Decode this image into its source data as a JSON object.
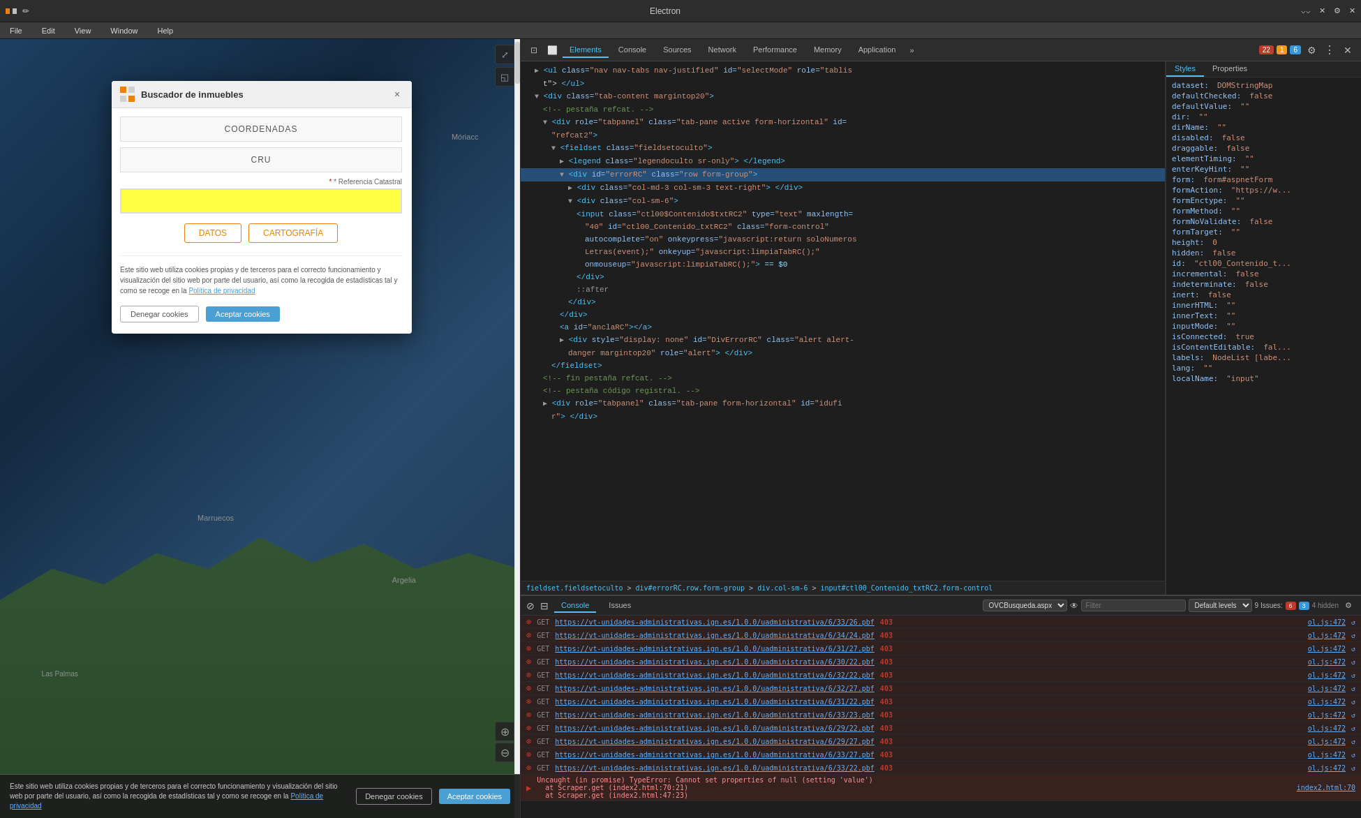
{
  "titleBar": {
    "title": "Electron",
    "iconColor1": "#e8820a",
    "iconColor2": "#e8820a"
  },
  "menuBar": {
    "items": [
      "File",
      "Edit",
      "View",
      "Window",
      "Help"
    ]
  },
  "modal": {
    "title": "Buscador de inmuebles",
    "closeLabel": "×",
    "section1": "COORDENADAS",
    "section2": "CRU",
    "referenciaCatastralLabel": "* Referencia Catastral",
    "inputValue": "~~~~~~~~~~~~~~~~~~~~~~~~~~",
    "datosBtn": "DATOS",
    "cartografiaBtn": "CARTOGRAFÍA",
    "cookieText": "Este sitio web utiliza cookies propias y de terceros para el correcto funcionamiento y visualización del sitio web por parte del usuario, así como la recogida de estadísticas tal y como se recoge en la ",
    "policyLink": "Política de privacidad",
    "denyBtn": "Denegar cookies",
    "acceptBtn": "Aceptar cookies"
  },
  "mapLabels": {
    "marruecos": "Marruecos",
    "argelia": "Argelia",
    "lasPalmas": "Las Palmas",
    "moriace": "Móriacc"
  },
  "cookieBarBottom": {
    "text": "Este sitio web utiliza cookies propias y de terceros para el correcto funcionamiento y visualización del sitio web por parte del usuario, así como la recogida de estadísticas tal y como se recoge en la ",
    "policyLink": "Política de privacidad",
    "denyBtn": "Denegar cookies",
    "acceptBtn": "Aceptar cookies"
  },
  "devtools": {
    "tabs": [
      "Elements",
      "Console",
      "Sources",
      "Network",
      "Performance",
      "Memory",
      "Application"
    ],
    "activeTab": "Elements",
    "badgeError": "22",
    "badgeWarn": "1",
    "badgeInfo": "6",
    "stylesTabs": [
      "Styles",
      "Properties"
    ],
    "activeStylesTab": "Styles"
  },
  "domTree": {
    "lines": [
      "▶ <ul class=\"nav nav-tabs nav-justified\" id=\"selectMode\" role=\"tablis",
      "  t\"> </ul>",
      "▼ <div class=\"tab-content margintop20\">",
      "  <!-- pestaña refcat. -->",
      "  ▼ <div role=\"tabpanel\" class=\"tab-pane active form-horizontal\" id=",
      "    \"refcat2\">",
      "    ▼ <fieldset class=\"fieldsetoculto\">",
      "      ▶ <legend class=\"legendoculto sr-only\"> </legend>",
      "      ▼ <div id=\"errorRC\" class=\"row form-group\">",
      "        ▶ <div class=\"col-md-3 col-sm-3 text-right\"> </div>",
      "        ▼ <div class=\"col-sm-6\">",
      "          <input class=\"ctl00$Contenido$txtRC2\" type=\"text\" maxlength=",
      "            \"40\" id=\"ctl00_Contenido_txtRC2\" class=\"form-control\"",
      "            autocomplete=\"on\" onkeypress=\"javascript:return soloNumeros",
      "            Letras(event);\" onkeyup=\"javascript:limpiaTabRC();\"",
      "            onmouseup=\"javascript:limpiaTabRC();\"> == $0",
      "          </div>",
      "          ::after",
      "        </div>",
      "      </div>",
      "      <a id=\"anclaRC\"></a>",
      "      ▶ <div style=\"display: none\" id=\"DivErrorRC\" class=\"alert alert-",
      "        danger margintop20\" role=\"alert\"> </div>",
      "    </fieldset>",
      "  <!-- fin pestaña refcat. -->",
      "  <!-- pestaña código registral. -->",
      "  ▶ <div role=\"tabpanel\" class=\"tab-pane form-horizontal\" id=\"idufi",
      "    r\"> </div>"
    ]
  },
  "breadcrumb": {
    "parts": [
      "fieldsetoculto",
      "div#errorRC.row.form-group",
      "div.col-sm-6",
      "input#ctl00_Contenido_txtRC2.form-control"
    ]
  },
  "stylesContent": {
    "props": [
      {
        "key": "dataset:",
        "val": "DOMStringMap"
      },
      {
        "key": "defaultChecked:",
        "val": "false"
      },
      {
        "key": "defaultValue:",
        "val": "\"\""
      },
      {
        "key": "dir:",
        "val": "\"\""
      },
      {
        "key": "dirName:",
        "val": "\"\""
      },
      {
        "key": "disabled:",
        "val": "false"
      },
      {
        "key": "draggable:",
        "val": "false"
      },
      {
        "key": "elementTiming:",
        "val": "\"\""
      },
      {
        "key": "enterKeyHint:",
        "val": "\"\""
      },
      {
        "key": "form:",
        "val": "form#aspnetForm"
      },
      {
        "key": "formAction:",
        "val": "\"https://w..."
      },
      {
        "key": "formEnctype:",
        "val": "\"\""
      },
      {
        "key": "formMethod:",
        "val": "\"\""
      },
      {
        "key": "formNoValidate:",
        "val": "false"
      },
      {
        "key": "formTarget:",
        "val": "\"\""
      },
      {
        "key": "height:",
        "val": "0"
      },
      {
        "key": "hidden:",
        "val": "false"
      },
      {
        "key": "id:",
        "val": "\"ctl00_Contenido_t..."
      },
      {
        "key": "incremental:",
        "val": "false"
      },
      {
        "key": "indeterminate:",
        "val": "false"
      },
      {
        "key": "inert:",
        "val": "false"
      },
      {
        "key": "innerHTML:",
        "val": "\"\""
      },
      {
        "key": "innerText:",
        "val": "\"\""
      },
      {
        "key": "inputMode:",
        "val": "\"\""
      },
      {
        "key": "isConnected:",
        "val": "true"
      },
      {
        "key": "isContentEditable:",
        "val": "fal..."
      },
      {
        "key": "labels:",
        "val": "NodeList [labe..."
      },
      {
        "key": "lang:",
        "val": "\"\""
      },
      {
        "key": "localName:",
        "val": "\"input\""
      }
    ]
  },
  "consoleToolbar": {
    "fileName": "OVCBusqueda.aspx",
    "filterPlaceholder": "Filter",
    "levelDefault": "Default levels",
    "issuesCount": "9 Issues:",
    "errorCount": "6",
    "issuesBadge": "3",
    "hiddenCount": "4 hidden"
  },
  "consoleRows": [
    {
      "type": "error",
      "method": "GET",
      "url": "https://vt-unidades-administrativas.ign.es/1.0.0/uadministrativa/6/33/26.pbf",
      "status": "403",
      "file": "ol.js:472",
      "isError": true
    },
    {
      "type": "error",
      "method": "GET",
      "url": "https://vt-unidades-administrativas.ign.es/1.0.0/uadministrativa/6/34/24.pbf",
      "status": "403",
      "file": "ol.js:472",
      "isError": true
    },
    {
      "type": "error",
      "method": "GET",
      "url": "https://vt-unidades-administrativas.ign.es/1.0.0/uadministrativa/6/31/27.pbf",
      "status": "403",
      "file": "ol.js:472",
      "isError": true
    },
    {
      "type": "error",
      "method": "GET",
      "url": "https://vt-unidades-administrativas.ign.es/1.0.0/uadministrativa/6/30/22.pbf",
      "status": "403",
      "file": "ol.js:472",
      "isError": true
    },
    {
      "type": "error",
      "method": "GET",
      "url": "https://vt-unidades-administrativas.ign.es/1.0.0/uadministrativa/6/32/22.pbf",
      "status": "403",
      "file": "ol.js:472",
      "isError": true
    },
    {
      "type": "error",
      "method": "GET",
      "url": "https://vt-unidades-administrativas.ign.es/1.0.0/uadministrativa/6/32/27.pbf",
      "status": "403",
      "file": "ol.js:472",
      "isError": true
    },
    {
      "type": "error",
      "method": "GET",
      "url": "https://vt-unidades-administrativas.ign.es/1.0.0/uadministrativa/6/31/22.pbf",
      "status": "403",
      "file": "ol.js:472",
      "isError": true
    },
    {
      "type": "error",
      "method": "GET",
      "url": "https://vt-unidades-administrativas.ign.es/1.0.0/uadministrativa/6/33/23.pbf",
      "status": "403",
      "file": "ol.js:472",
      "isError": true
    },
    {
      "type": "error",
      "method": "GET",
      "url": "https://vt-unidades-administrativas.ign.es/1.0.0/uadministrativa/6/29/22.pbf",
      "status": "403",
      "file": "ol.js:472",
      "isError": true
    },
    {
      "type": "error",
      "method": "GET",
      "url": "https://vt-unidades-administrativas.ign.es/1.0.0/uadministrativa/6/29/27.pbf",
      "status": "403",
      "file": "ol.js:472",
      "isError": true
    },
    {
      "type": "error",
      "method": "GET",
      "url": "https://vt-unidades-administrativas.ign.es/1.0.0/uadministrativa/6/33/27.pbf",
      "status": "403",
      "file": "ol.js:472",
      "isError": true
    },
    {
      "type": "error",
      "method": "GET",
      "url": "https://vt-unidades-administrativas.ign.es/1.0.0/uadministrativa/6/33/22.pbf",
      "status": "403",
      "file": "ol.js:472",
      "isError": true
    },
    {
      "type": "error-text",
      "text": "▶ Uncaught (in promise) TypeError: Cannot set properties of null (setting 'value')",
      "subtext": "  at Scraper.get (index2.html:70:21)",
      "subtext2": "  at Scraper.get (index2.html:47:23)",
      "file": "index2.html:70",
      "isError": true
    }
  ]
}
